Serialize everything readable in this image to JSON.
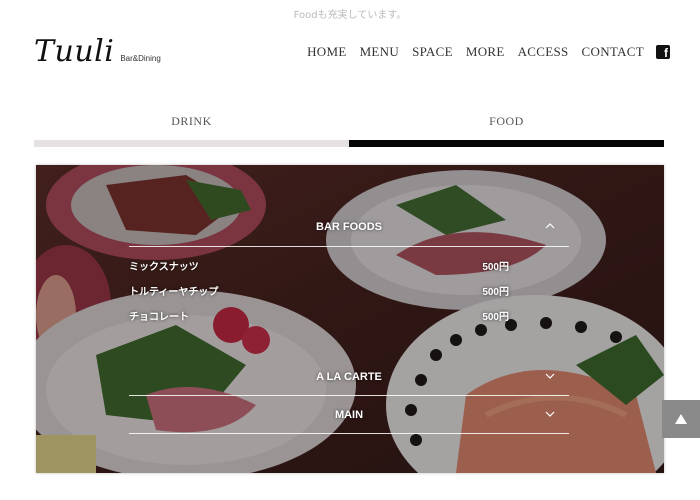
{
  "top_note": "Foodも充実しています。",
  "logo": {
    "main": "Tuuli",
    "sub": "Bar&Dining"
  },
  "nav": {
    "items": [
      "HOME",
      "MENU",
      "SPACE",
      "MORE",
      "ACCESS",
      "CONTACT"
    ],
    "facebook_icon": "facebook-icon"
  },
  "tabs": [
    {
      "label": "DRINK",
      "active": false
    },
    {
      "label": "FOOD",
      "active": true
    }
  ],
  "menu": {
    "sections": [
      {
        "title": "BAR FOODS",
        "expanded": true,
        "items": [
          {
            "name": "ミックスナッツ",
            "price": "500円"
          },
          {
            "name": "トルティーヤチップ",
            "price": "500円"
          },
          {
            "name": "チョコレート",
            "price": "500円"
          }
        ]
      },
      {
        "title": "A LA CARTE",
        "expanded": false
      },
      {
        "title": "MAIN",
        "expanded": false
      }
    ]
  },
  "colors": {
    "active_tab_bar": "#050505",
    "inactive_tab_bar": "#e6e2e3",
    "scroll_button": "#8a8a8a"
  }
}
